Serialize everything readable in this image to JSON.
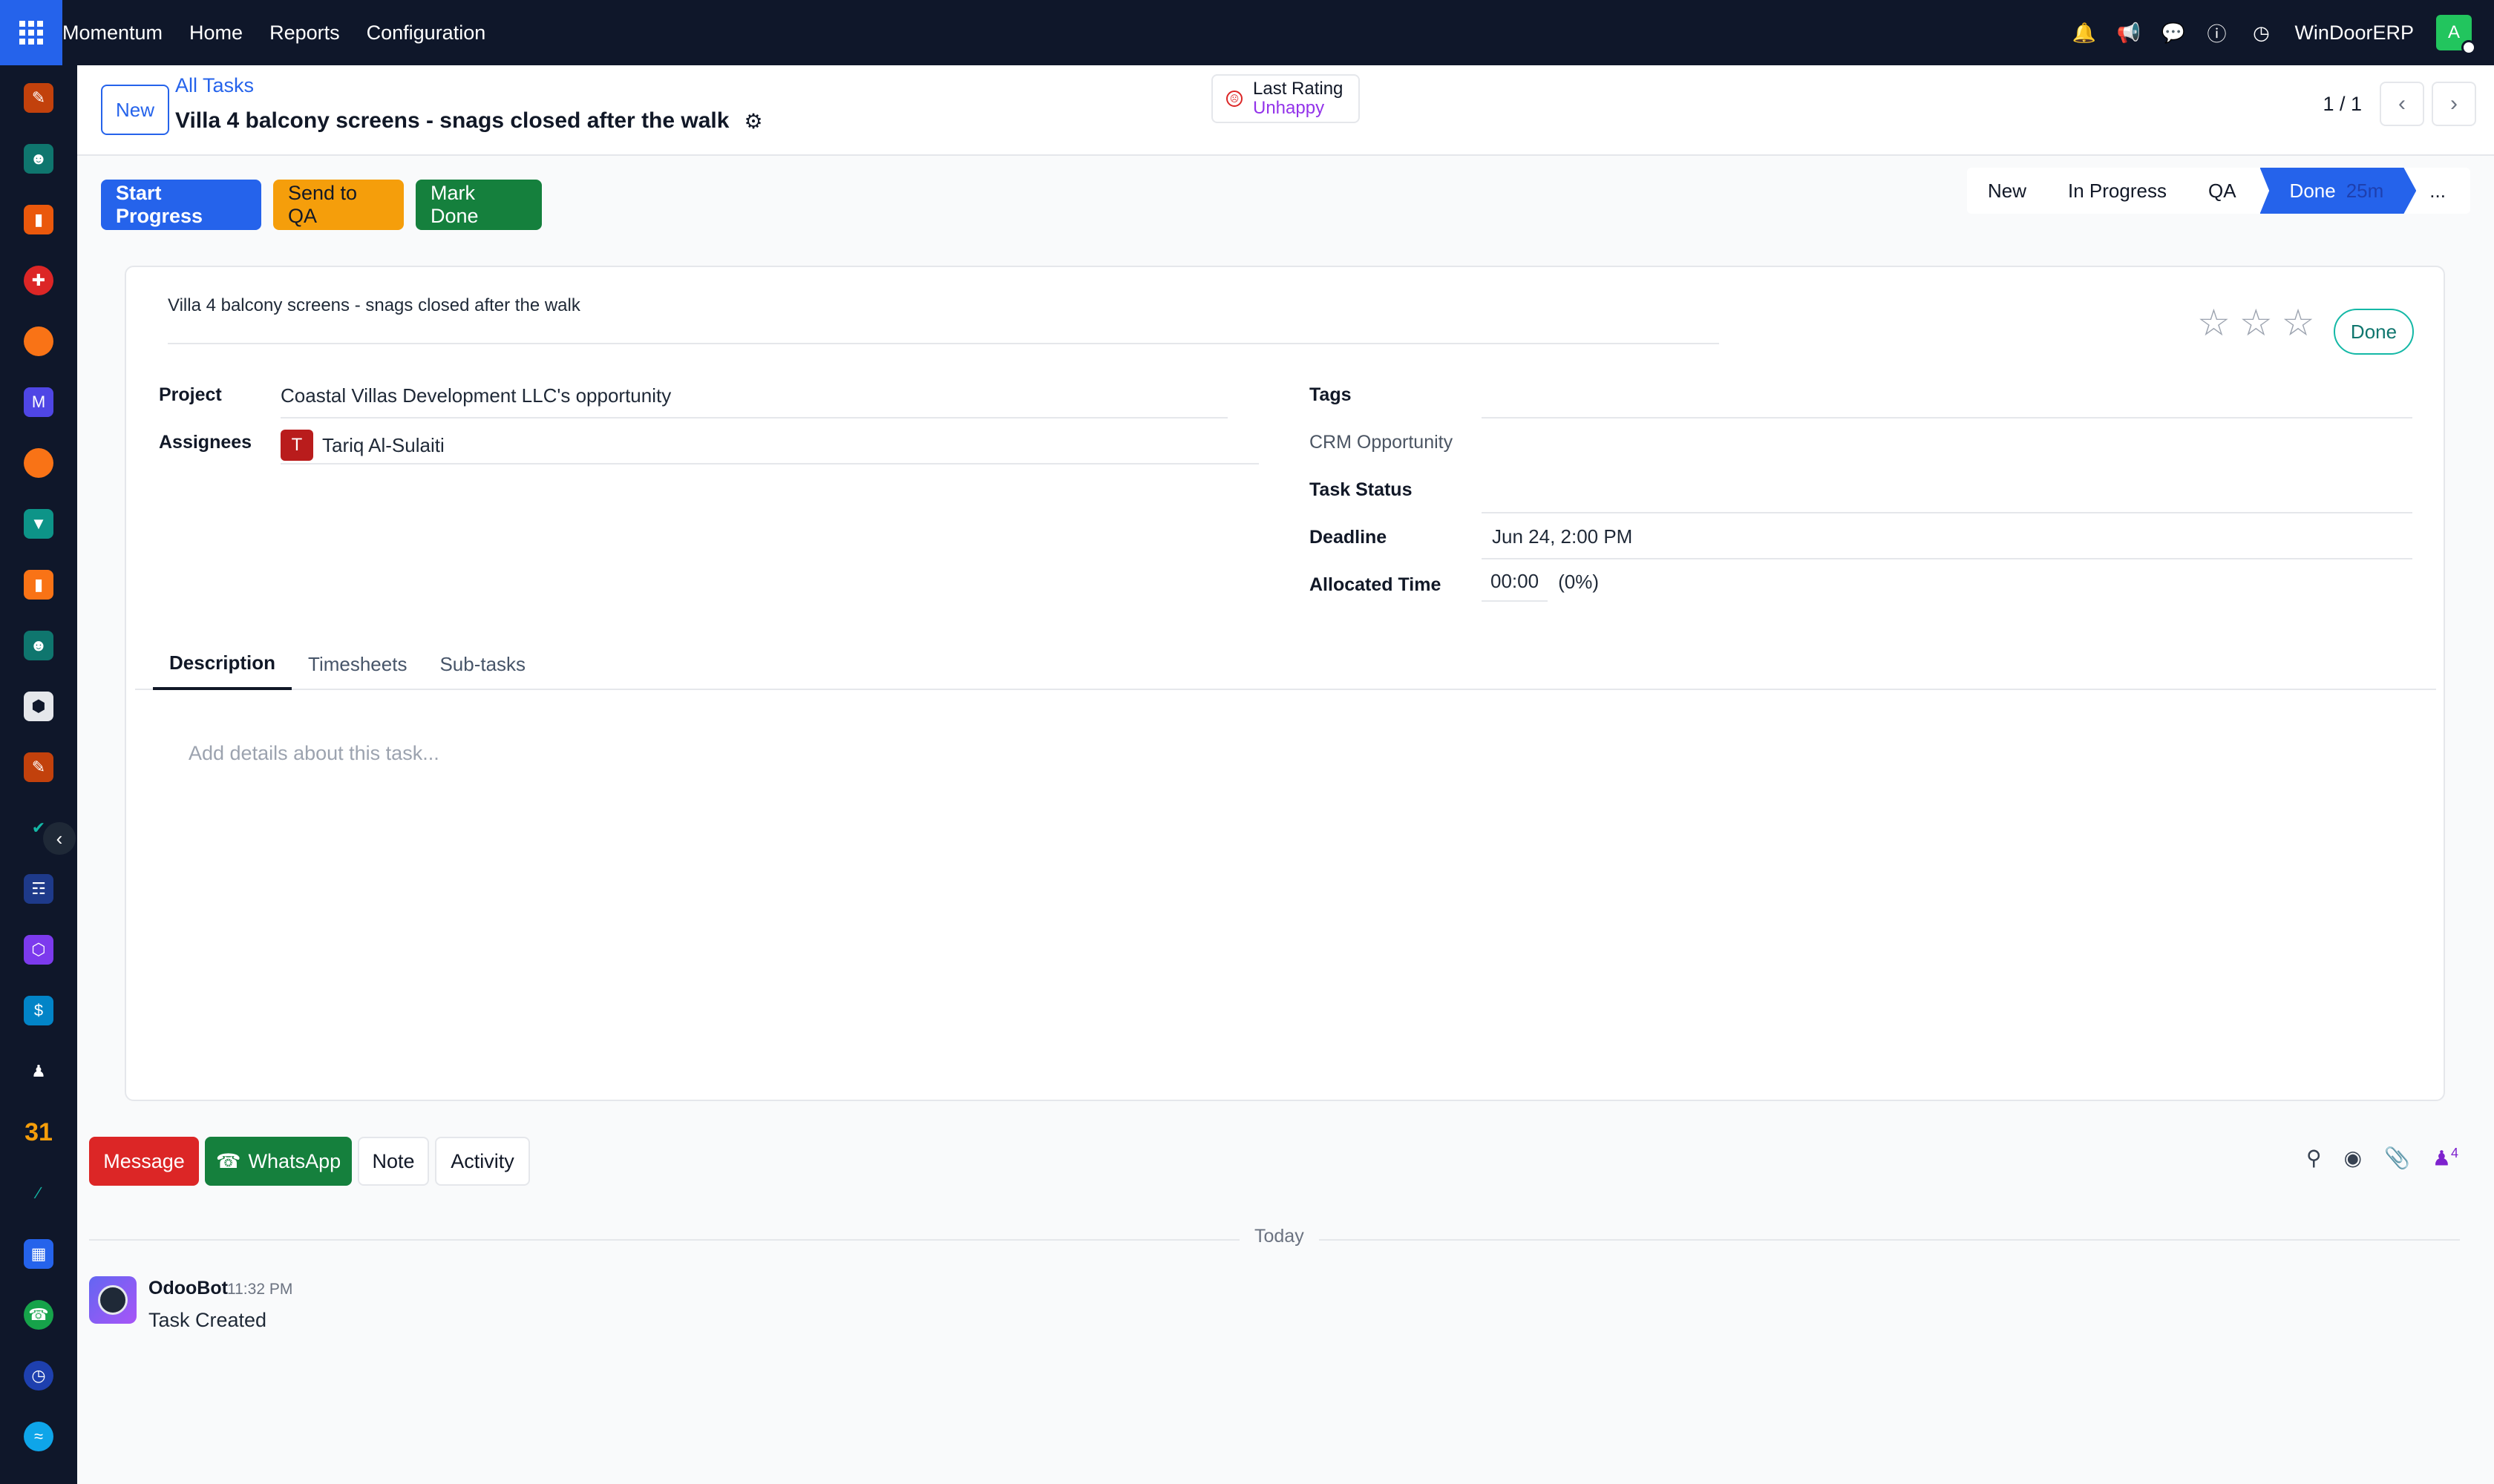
{
  "topbar": {
    "brand": "Momentum",
    "menu": [
      "Home",
      "Reports",
      "Configuration"
    ],
    "company": "WinDoorERP",
    "user_initial": "A",
    "icons": [
      "bell-icon",
      "megaphone-icon",
      "chat-icon",
      "help-icon",
      "clock-icon"
    ]
  },
  "control": {
    "new_label": "New",
    "breadcrumb": "All Tasks",
    "title": "Villa 4 balcony screens - snags closed after the walk",
    "rating_label": "Last Rating",
    "rating_value": "Unhappy",
    "pager_value": "1 / 1"
  },
  "actions": {
    "start": "Start Progress",
    "qa": "Send to QA",
    "done": "Mark Done"
  },
  "statusbar": {
    "stages": [
      "New",
      "In Progress",
      "QA"
    ],
    "active_stage": "Done",
    "active_timer": "25m",
    "more": "..."
  },
  "form": {
    "task_name": "Villa 4 balcony screens - snags closed after the walk",
    "kanban_state": "Done",
    "fields": {
      "project_label": "Project",
      "project_value": "Coastal Villas Development LLC's opportunity",
      "assignees_label": "Assignees",
      "assignee_initial": "T",
      "assignee_name": "Tariq Al-Sulaiti",
      "tags_label": "Tags",
      "crm_label": "CRM Opportunity",
      "status_label": "Task Status",
      "deadline_label": "Deadline",
      "deadline_value": "Jun 24, 2:00 PM",
      "allocated_label": "Allocated Time",
      "allocated_value": "00:00",
      "allocated_pct": "(0%)"
    },
    "tabs": [
      "Description",
      "Timesheets",
      "Sub-tasks"
    ],
    "description_placeholder": "Add details about this task..."
  },
  "chatter": {
    "buttons": [
      "Message",
      "WhatsApp",
      "Note",
      "Activity"
    ],
    "followers_count": "4",
    "divider": "Today",
    "messages": [
      {
        "author": "OdooBot",
        "time": "11:32 PM",
        "body": "Task Created"
      }
    ]
  },
  "sidebar": {
    "icons": [
      "documents-icon",
      "contacts-icon",
      "sales-icon",
      "dashboard-icon",
      "discuss-icon",
      "email-icon",
      "livechat-icon",
      "crm-icon",
      "reports-icon",
      "employees-icon",
      "inventory-icon",
      "documents-2-icon",
      "todo-icon",
      "knowledge-icon",
      "products-icon",
      "invoicing-icon",
      "team-icon",
      "calendar-icon",
      "sign-icon",
      "apps-icon",
      "whatsapp-icon",
      "timer-icon",
      "website-icon"
    ],
    "calendar_label": "31"
  },
  "colors": {
    "primary": "#2563eb",
    "warning": "#f59e0b",
    "success": "#15803d",
    "danger": "#dc2626",
    "nav_bg": "#0f172a"
  }
}
